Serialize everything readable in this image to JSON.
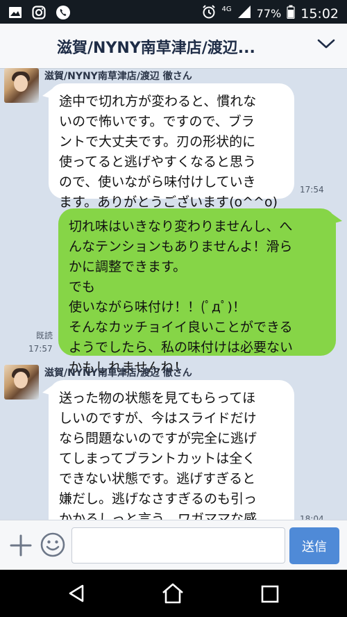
{
  "status_bar": {
    "icons_left": [
      "image-icon",
      "instagram-icon",
      "phone-icon"
    ],
    "icons_right": [
      "alarm-icon",
      "signal-icon",
      "battery-icon"
    ],
    "network": "4G",
    "battery": "77%",
    "time": "15:02"
  },
  "header": {
    "title": "滋賀/NYNY南草津店/渡辺...",
    "menu_icon": "chevron-down-icon"
  },
  "messages": [
    {
      "direction": "incoming",
      "sender": "滋賀/NYNY南草津店/渡辺 徹さん",
      "text": "途中で切れ方が変わると、慣れな\nいので怖いです。ですので、ブラ\nントで大丈夫です。刃の形状的に\n使ってると逃げやすくなると思う\nので、使いながら味付けしていき\nます。ありがとうございます(o^^o)",
      "time": "17:54"
    },
    {
      "direction": "outgoing",
      "text": "切れ味はいきなり変わりませんし、へ\nんなテンションもありませんよ！滑ら\nかに調整できます。\nでも\n使いながら味付け！！(ﾟдﾟ)！\nそんなカッチョイイ良いことができる\nようでしたら、私の味付けは必要ない\nかもしれませんね！",
      "read": "既読",
      "time": "17:57"
    },
    {
      "direction": "incoming",
      "sender": "滋賀/NYNY南草津店/渡辺 徹さん",
      "text": "送った物の状態を見てもらってほ\nしいのですが、今はスライドだけ\nなら問題ないのですが完全に逃げ\nてしまってブラントカットは全く\nできない状態です。逃げすぎると\n嫌だし。逃げなさすぎるのも引っ\nかかるしっと言う、ワガママな感\nじです。すいません。",
      "time": "18:04"
    }
  ],
  "input": {
    "placeholder": "",
    "send_label": "送信",
    "plus_icon": "plus-icon",
    "emoji_icon": "emoji-icon"
  },
  "nav": [
    "back-icon",
    "home-icon",
    "recent-apps-icon"
  ],
  "colors": {
    "chat_bg": "#d7e0ec",
    "outgoing_bubble": "#86d547",
    "incoming_bubble": "#ffffff",
    "send_button": "#4f8ad7",
    "status_bar": "#141b22"
  }
}
